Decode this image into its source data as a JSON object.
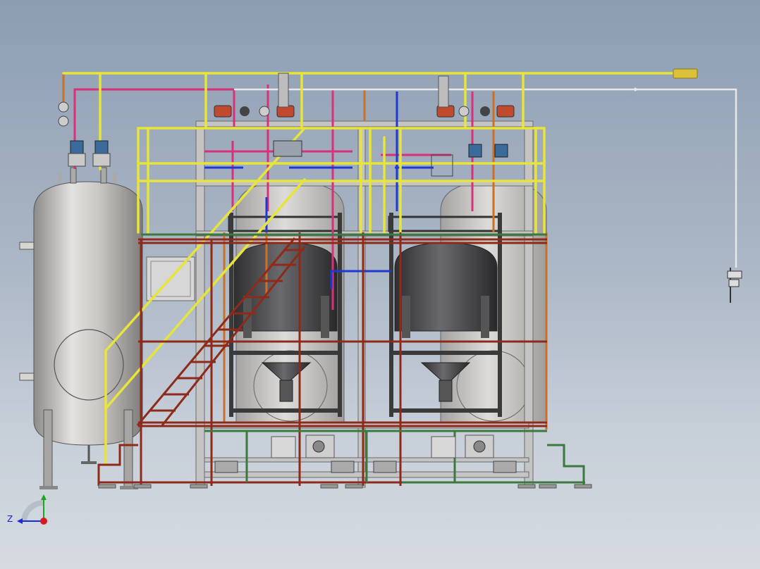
{
  "scene": {
    "subject": "water-treatment-skid",
    "background_top": "#8c9db2",
    "background_bottom": "#d6dbe1",
    "colors": {
      "yellow_pipe": "#e7e43a",
      "magenta_pipe": "#d8317a",
      "blue_pipe": "#1e38d0",
      "orange_pipe": "#c9702b",
      "red_frame": "#8e2a1a",
      "green_frame": "#3a7a3c",
      "steel": "#b9b9b9",
      "tank_body": "#c8c5c2",
      "filter_tank": "#4a4a4c",
      "valve_red": "#c14a2e",
      "valve_blue": "#3b6b9a"
    }
  },
  "triad": {
    "z_label": "Z",
    "x_color": "#1a2ad8",
    "y_color": "#18a81a",
    "origin_color": "#d81a1a"
  }
}
